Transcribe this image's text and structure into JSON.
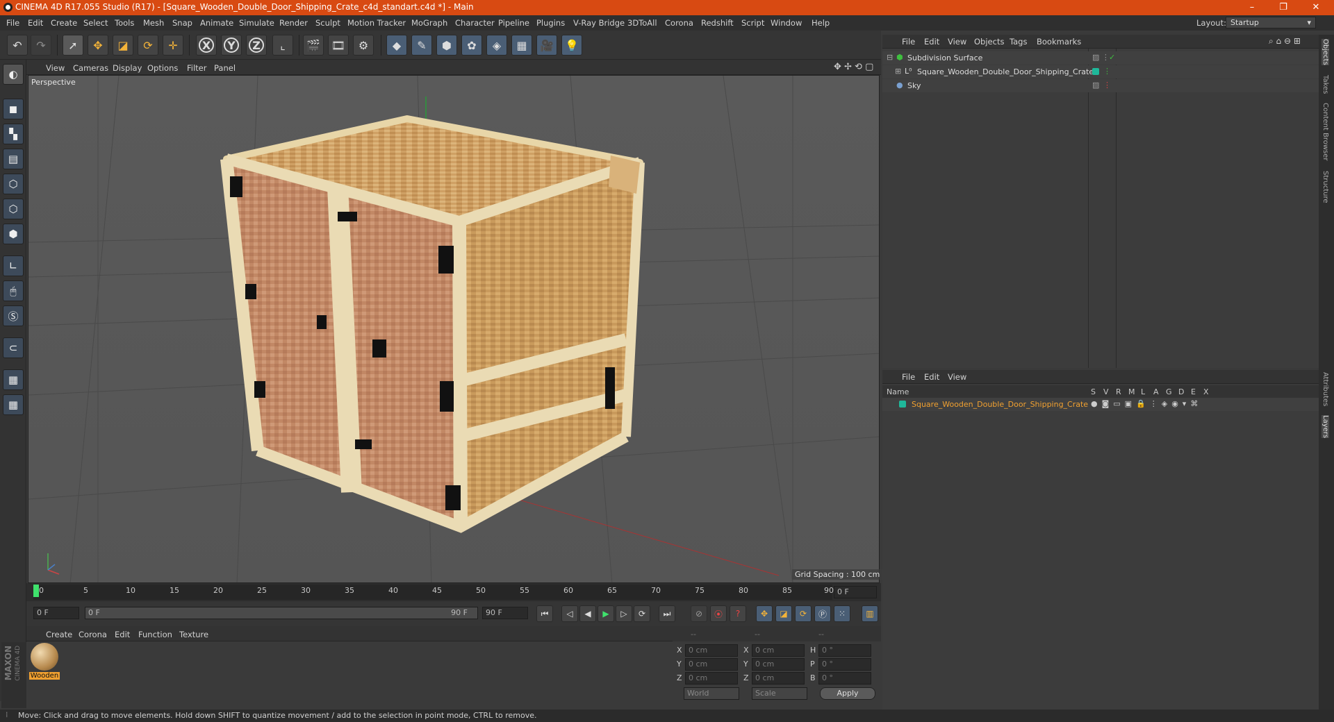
{
  "window": {
    "title": "CINEMA 4D R17.055 Studio (R17) - [Square_Wooden_Double_Door_Shipping_Crate_c4d_standart.c4d *] - Main",
    "minimize": "–",
    "restore": "❐",
    "close": "✕"
  },
  "menubar": {
    "items": [
      "File",
      "Edit",
      "Create",
      "Select",
      "Tools",
      "Mesh",
      "Snap",
      "Animate",
      "Simulate",
      "Render",
      "Sculpt",
      "Motion Tracker",
      "MoGraph",
      "Character",
      "Pipeline",
      "Plugins",
      "V-Ray Bridge",
      "3DToAll",
      "Corona",
      "Redshift",
      "Script",
      "Window",
      "Help"
    ],
    "layout_label": "Layout:",
    "layout_value": "Startup"
  },
  "toolbar": {
    "axis_x": "X",
    "axis_y": "Y",
    "axis_z": "Z"
  },
  "viewport": {
    "menu": [
      "View",
      "Cameras",
      "Display",
      "Options",
      "Filter",
      "Panel"
    ],
    "label": "Perspective",
    "grid_spacing": "Grid Spacing : 100 cm"
  },
  "timeline": {
    "ticks": [
      "0",
      "5",
      "10",
      "15",
      "20",
      "25",
      "30",
      "35",
      "40",
      "45",
      "50",
      "55",
      "60",
      "65",
      "70",
      "75",
      "80",
      "85",
      "90"
    ],
    "current_frame": "0 F",
    "start_field": "0 F",
    "range_start": "0 F",
    "range_end": "90 F",
    "end_field": "90 F"
  },
  "material_manager": {
    "menu": [
      "Create",
      "Corona",
      "Edit",
      "Function",
      "Texture"
    ],
    "materials": [
      {
        "name": "Wooden"
      }
    ]
  },
  "coordinates": {
    "header": [
      "--",
      "--",
      "--"
    ],
    "rows": [
      {
        "a": "X",
        "av": "0 cm",
        "b": "X",
        "bv": "0 cm",
        "c": "H",
        "cv": "0 °"
      },
      {
        "a": "Y",
        "av": "0 cm",
        "b": "Y",
        "bv": "0 cm",
        "c": "P",
        "cv": "0 °"
      },
      {
        "a": "Z",
        "av": "0 cm",
        "b": "Z",
        "bv": "0 cm",
        "c": "B",
        "cv": "0 °"
      }
    ],
    "mode": "World",
    "scale": "Scale",
    "apply": "Apply"
  },
  "object_manager": {
    "menu": [
      "File",
      "Edit",
      "View",
      "Objects",
      "Tags",
      "Bookmarks"
    ],
    "objects": [
      {
        "name": "Subdivision Surface"
      },
      {
        "name": "Square_Wooden_Double_Door_Shipping_Crate"
      },
      {
        "name": "Sky"
      }
    ]
  },
  "layer_manager": {
    "menu": [
      "File",
      "Edit",
      "View"
    ],
    "columns": [
      "Name",
      "S",
      "V",
      "R",
      "M",
      "L",
      "A",
      "G",
      "D",
      "E",
      "X"
    ],
    "layers": [
      {
        "name": "Square_Wooden_Double_Door_Shipping_Crate",
        "color": "#1fb89a"
      }
    ]
  },
  "right_tabs": [
    "Objects",
    "Takes",
    "Content Browser",
    "Structure",
    "Attributes",
    "Layers"
  ],
  "status_bar": {
    "text": "Move: Click and drag to move elements. Hold down SHIFT to quantize movement / add to the selection in point mode, CTRL to remove."
  },
  "branding": {
    "maxon": "MAXON",
    "product": "CINEMA 4D"
  },
  "colors": {
    "title_bar": "#d84a12",
    "accent_orange": "#f0a030",
    "layer_teal": "#1fb89a"
  }
}
